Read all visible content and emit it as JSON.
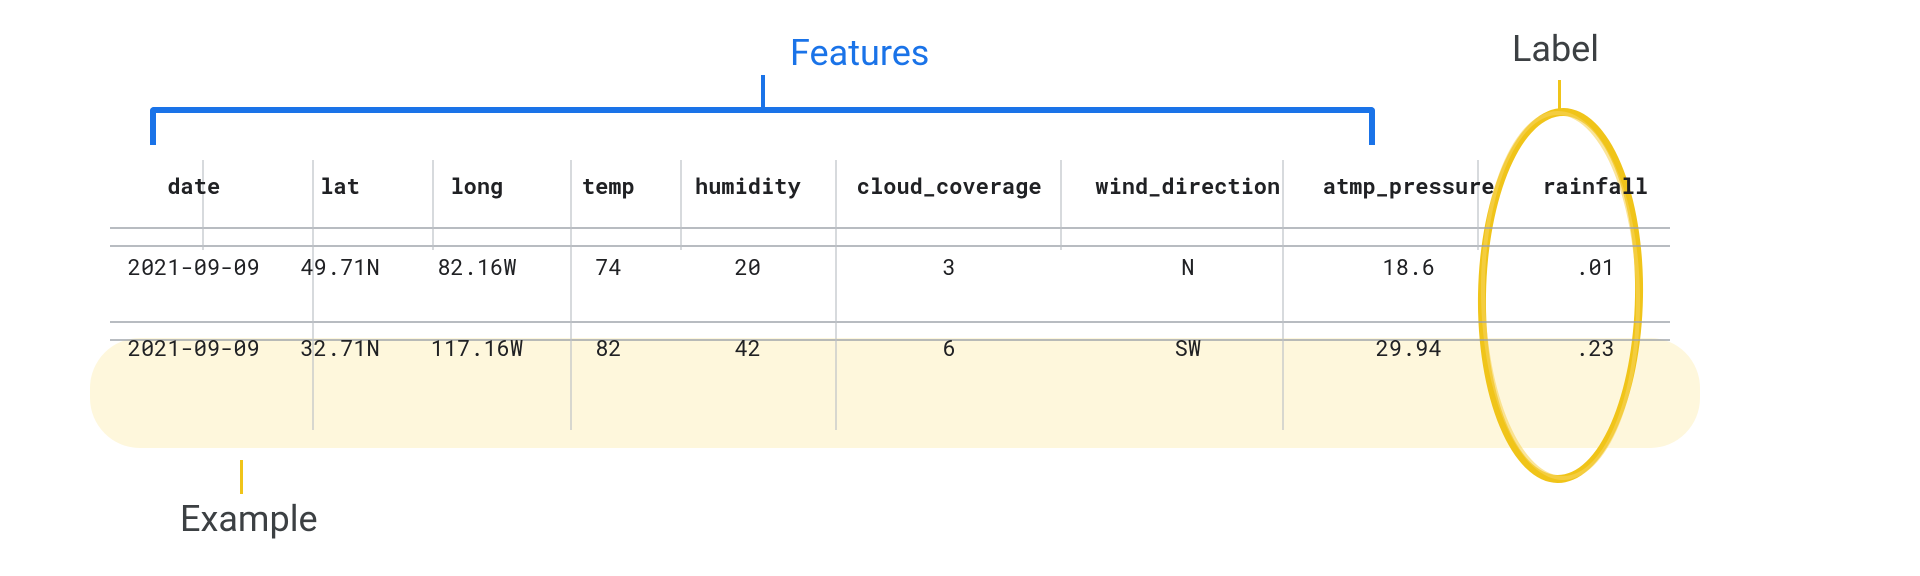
{
  "annotations": {
    "features_label": "Features",
    "label_label": "Label",
    "example_label": "Example"
  },
  "chart_data": {
    "type": "table",
    "title": "",
    "columns": [
      "date",
      "lat",
      "long",
      "temp",
      "humidity",
      "cloud_coverage",
      "wind_direction",
      "atmp_pressure",
      "rainfall"
    ],
    "feature_columns": [
      "date",
      "lat",
      "long",
      "temp",
      "humidity",
      "cloud_coverage",
      "wind_direction",
      "atmp_pressure"
    ],
    "label_column": "rainfall",
    "rows": [
      {
        "date": "2021-09-09",
        "lat": "49.71N",
        "long": "82.16W",
        "temp": "74",
        "humidity": "20",
        "cloud_coverage": "3",
        "wind_direction": "N",
        "atmp_pressure": "18.6",
        "rainfall": ".01"
      },
      {
        "date": "2021-09-09",
        "lat": "32.71N",
        "long": "117.16W",
        "temp": "82",
        "humidity": "42",
        "cloud_coverage": "6",
        "wind_direction": "SW",
        "atmp_pressure": "29.94",
        "rainfall": ".23"
      }
    ],
    "highlighted_example_row_index": 1
  }
}
